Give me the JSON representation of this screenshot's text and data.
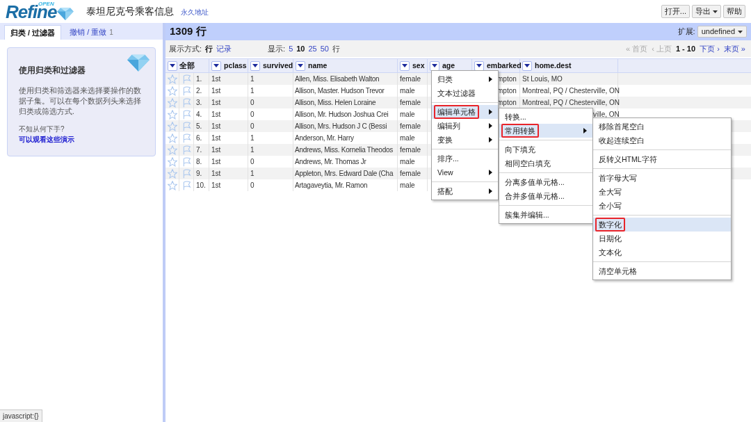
{
  "header": {
    "logo_badge": "OPEN",
    "logo": "Refine",
    "project_title": "泰坦尼克号乘客信息",
    "permalink": "永久地址",
    "buttons": [
      {
        "label": "打开...",
        "dropdown": false
      },
      {
        "label": "导出",
        "dropdown": true
      },
      {
        "label": "帮助",
        "dropdown": false
      }
    ]
  },
  "left_panel": {
    "tabs": [
      {
        "label": "归类 / 过滤器",
        "selected": true
      },
      {
        "label": "撤销 / 重做",
        "count": "1",
        "selected": false
      }
    ],
    "card": {
      "title": "使用归类和过滤器",
      "body": "使用归类和筛选器来选择要操作的数据子集。可以在每个数据列头来选择归类或筛选方式.",
      "question": "不知从何下手?",
      "link": "可以观看这些演示"
    }
  },
  "data_panel": {
    "row_count": "1309 行",
    "extensions_label": "扩展:",
    "extensions_value": "undefined",
    "view_label": "展示方式:",
    "view_modes": [
      {
        "label": "行",
        "selected": true
      },
      {
        "label": "记录",
        "selected": false
      }
    ],
    "show_label": "显示:",
    "page_sizes": [
      {
        "label": "5",
        "selected": false
      },
      {
        "label": "10",
        "selected": true
      },
      {
        "label": "25",
        "selected": false
      },
      {
        "label": "50",
        "selected": false
      }
    ],
    "show_unit": "行",
    "pager": [
      {
        "label": "« 首页",
        "kind": "disabled"
      },
      {
        "label": "‹ 上页",
        "kind": "disabled"
      },
      {
        "label": "1 - 10",
        "kind": "current"
      },
      {
        "label": "下页 ›",
        "kind": "link"
      },
      {
        "label": "末页 »",
        "kind": "link"
      }
    ],
    "table": {
      "all_label": "全部",
      "columns": [
        "pclass",
        "survived",
        "name",
        "sex",
        "age",
        "embarked",
        "home.dest"
      ],
      "rows": [
        {
          "starred": false,
          "flagged": false,
          "index": "1.",
          "pclass": "1st",
          "survived": "1",
          "name": "Allen, Miss. Elisabeth Walton",
          "sex": "female",
          "embarked": {
            "text": "mpton",
            "cut": true
          },
          "home_dest": {
            "text": "St Louis, MO",
            "cut": false
          }
        },
        {
          "starred": false,
          "flagged": false,
          "index": "2.",
          "pclass": "1st",
          "survived": "1",
          "name": "Allison, Master. Hudson Trevor",
          "sex": "male",
          "embarked": {
            "text": "mpton",
            "cut": true
          },
          "home_dest": {
            "text": "Montreal, PQ / Chesterville, ON",
            "cut": false
          }
        },
        {
          "starred": false,
          "flagged": false,
          "index": "3.",
          "pclass": "1st",
          "survived": "0",
          "name": "Allison, Miss. Helen Loraine",
          "sex": "female",
          "embarked": {
            "text": "mpton",
            "cut": true
          },
          "home_dest": {
            "text": "Montreal, PQ / Chesterville, ON",
            "cut": false
          }
        },
        {
          "starred": false,
          "flagged": false,
          "index": "4.",
          "pclass": "1st",
          "survived": "0",
          "name": "Allison, Mr. Hudson Joshua Crei",
          "sex": "male",
          "home_dest": {
            "text": "ville, ON",
            "cut": true
          }
        },
        {
          "starred": false,
          "flagged": false,
          "index": "5.",
          "pclass": "1st",
          "survived": "0",
          "name": "Allison, Mrs. Hudson J C (Bessi",
          "sex": "female"
        },
        {
          "starred": false,
          "flagged": false,
          "index": "6.",
          "pclass": "1st",
          "survived": "1",
          "name": "Anderson, Mr. Harry",
          "sex": "male"
        },
        {
          "starred": false,
          "flagged": false,
          "index": "7.",
          "pclass": "1st",
          "survived": "1",
          "name": "Andrews, Miss. Kornelia Theodos",
          "sex": "female"
        },
        {
          "starred": false,
          "flagged": false,
          "index": "8.",
          "pclass": "1st",
          "survived": "0",
          "name": "Andrews, Mr. Thomas Jr",
          "sex": "male"
        },
        {
          "starred": false,
          "flagged": false,
          "index": "9.",
          "pclass": "1st",
          "survived": "1",
          "name": "Appleton, Mrs. Edward Dale (Cha",
          "sex": "female"
        },
        {
          "starred": false,
          "flagged": false,
          "index": "10.",
          "pclass": "1st",
          "survived": "0",
          "name": "Artagaveytia, Mr. Ramon",
          "sex": "male"
        }
      ]
    }
  },
  "column_menu": [
    {
      "kind": "item",
      "label": "归类",
      "submenu": true,
      "selected": false,
      "marked": false
    },
    {
      "kind": "item",
      "label": "文本过滤器",
      "submenu": false,
      "selected": false,
      "marked": false
    },
    {
      "kind": "separator"
    },
    {
      "kind": "item",
      "label": "编辑单元格",
      "submenu": true,
      "selected": true,
      "marked": true
    },
    {
      "kind": "item",
      "label": "编辑列",
      "submenu": true,
      "selected": false,
      "marked": false
    },
    {
      "kind": "item",
      "label": "变换",
      "submenu": true,
      "selected": false,
      "marked": false
    },
    {
      "kind": "separator"
    },
    {
      "kind": "item",
      "label": "排序...",
      "submenu": false,
      "selected": false,
      "marked": false
    },
    {
      "kind": "item",
      "label": "View",
      "submenu": true,
      "selected": false,
      "marked": false
    },
    {
      "kind": "separator"
    },
    {
      "kind": "item",
      "label": "搭配",
      "submenu": true,
      "selected": false,
      "marked": false
    }
  ],
  "edit_cells_menu": [
    {
      "kind": "item",
      "label": "转换...",
      "submenu": false,
      "selected": false,
      "marked": false
    },
    {
      "kind": "item",
      "label": "常用转换",
      "submenu": true,
      "selected": true,
      "marked": true
    },
    {
      "kind": "separator"
    },
    {
      "kind": "item",
      "label": "向下填充",
      "submenu": false,
      "selected": false,
      "marked": false
    },
    {
      "kind": "item",
      "label": "相同空白填充",
      "submenu": false,
      "selected": false,
      "marked": false
    },
    {
      "kind": "separator"
    },
    {
      "kind": "item",
      "label": "分离多值单元格...",
      "submenu": false,
      "selected": false,
      "marked": false
    },
    {
      "kind": "item",
      "label": "合并多值单元格...",
      "submenu": false,
      "selected": false,
      "marked": false
    },
    {
      "kind": "separator"
    },
    {
      "kind": "item",
      "label": "簇集并编辑...",
      "submenu": false,
      "selected": false,
      "marked": false
    }
  ],
  "transforms_menu": [
    {
      "kind": "item",
      "label": "移除首尾空白",
      "submenu": false,
      "selected": false,
      "marked": false
    },
    {
      "kind": "item",
      "label": "收起连续空白",
      "submenu": false,
      "selected": false,
      "marked": false
    },
    {
      "kind": "separator"
    },
    {
      "kind": "item",
      "label": "反转义HTML字符",
      "submenu": false,
      "selected": false,
      "marked": false
    },
    {
      "kind": "separator"
    },
    {
      "kind": "item",
      "label": "首字母大写",
      "submenu": false,
      "selected": false,
      "marked": false
    },
    {
      "kind": "item",
      "label": "全大写",
      "submenu": false,
      "selected": false,
      "marked": false
    },
    {
      "kind": "item",
      "label": "全小写",
      "submenu": false,
      "selected": false,
      "marked": false
    },
    {
      "kind": "separator"
    },
    {
      "kind": "item",
      "label": "数字化",
      "submenu": false,
      "selected": true,
      "marked": true
    },
    {
      "kind": "item",
      "label": "日期化",
      "submenu": false,
      "selected": false,
      "marked": false
    },
    {
      "kind": "item",
      "label": "文本化",
      "submenu": false,
      "selected": false,
      "marked": false
    },
    {
      "kind": "separator"
    },
    {
      "kind": "item",
      "label": "清空单元格",
      "submenu": false,
      "selected": false,
      "marked": false
    }
  ],
  "status_bar": "javascript:{}"
}
